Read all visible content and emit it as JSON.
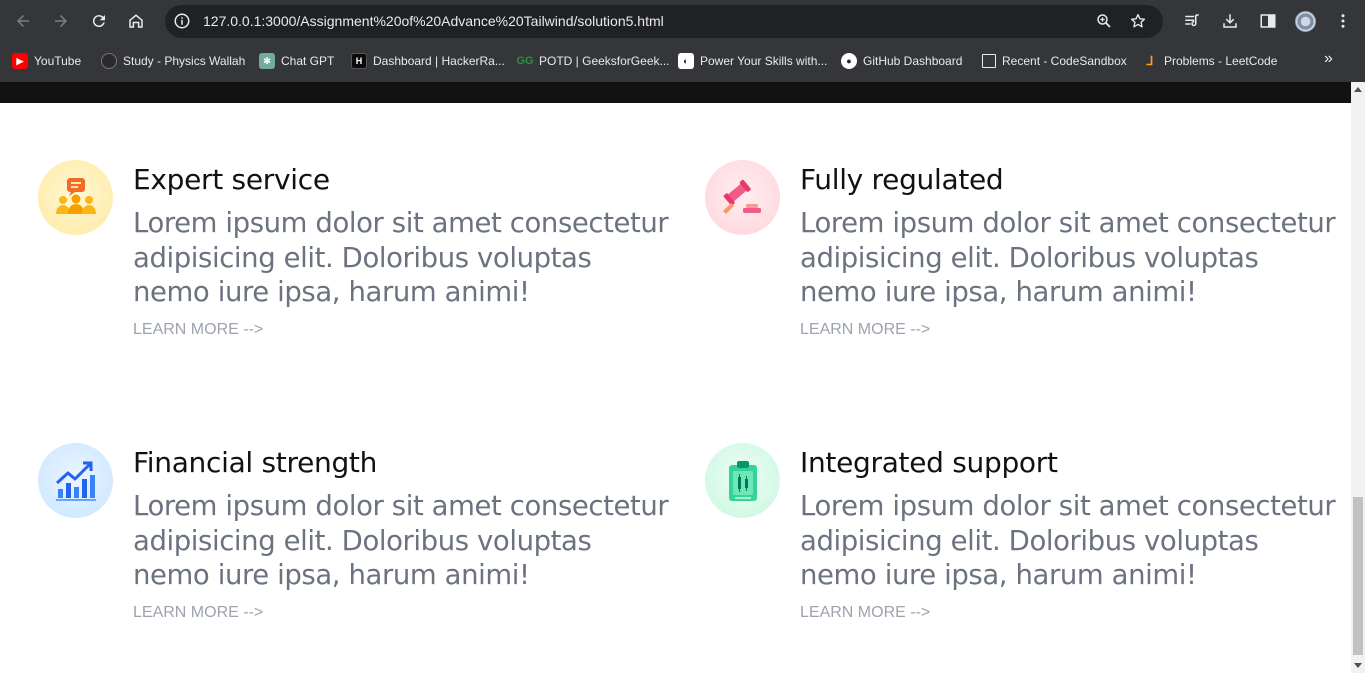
{
  "browser": {
    "url": "127.0.0.1:3000/Assignment%20of%20Advance%20Tailwind/solution5.html",
    "bookmarks": [
      {
        "label": "YouTube",
        "icon": "youtube-icon",
        "color": "#ff0000"
      },
      {
        "label": "Study - Physics Wallah",
        "icon": "physics-wallah-icon",
        "color": "#444444"
      },
      {
        "label": "Chat GPT",
        "icon": "chatgpt-icon",
        "color": "#74aa9c"
      },
      {
        "label": "Dashboard | HackerRa...",
        "icon": "hackerrank-icon",
        "color": "#0b0b0b"
      },
      {
        "label": "POTD | GeeksforGeek...",
        "icon": "geeksforgeeks-icon",
        "color": "#2f8d46"
      },
      {
        "label": "Power Your Skills with...",
        "icon": "skills-icon",
        "color": "#ffffff"
      },
      {
        "label": "GitHub Dashboard",
        "icon": "github-icon",
        "color": "#ffffff"
      },
      {
        "label": "Recent - CodeSandbox",
        "icon": "codesandbox-icon",
        "color": "#ffffff"
      },
      {
        "label": "Problems - LeetCode",
        "icon": "leetcode-icon",
        "color": "#ffa116"
      }
    ]
  },
  "features": [
    {
      "title": "Expert service",
      "body": "Lorem ipsum dolor sit amet consectetur adipisicing elit. Doloribus voluptas nemo iure ipsa, harum animi!",
      "link": "LEARN MORE -->",
      "icon": "team-chat-icon",
      "bg": "#fff3c4"
    },
    {
      "title": "Fully regulated",
      "body": "Lorem ipsum dolor sit amet consectetur adipisicing elit. Doloribus voluptas nemo iure ipsa, harum animi!",
      "link": "LEARN MORE -->",
      "icon": "gavel-icon",
      "bg": "#ffe1e6"
    },
    {
      "title": "Financial strength",
      "body": "Lorem ipsum dolor sit amet consectetur adipisicing elit. Doloribus voluptas nemo iure ipsa, harum animi!",
      "link": "LEARN MORE -->",
      "icon": "growth-chart-icon",
      "bg": "#dbeeff"
    },
    {
      "title": "Integrated support",
      "body": "Lorem ipsum dolor sit amet consectetur adipisicing elit. Doloribus voluptas nemo iure ipsa, harum animi!",
      "link": "LEARN MORE -->",
      "icon": "clipboard-candles-icon",
      "bg": "#dcfbec"
    }
  ]
}
